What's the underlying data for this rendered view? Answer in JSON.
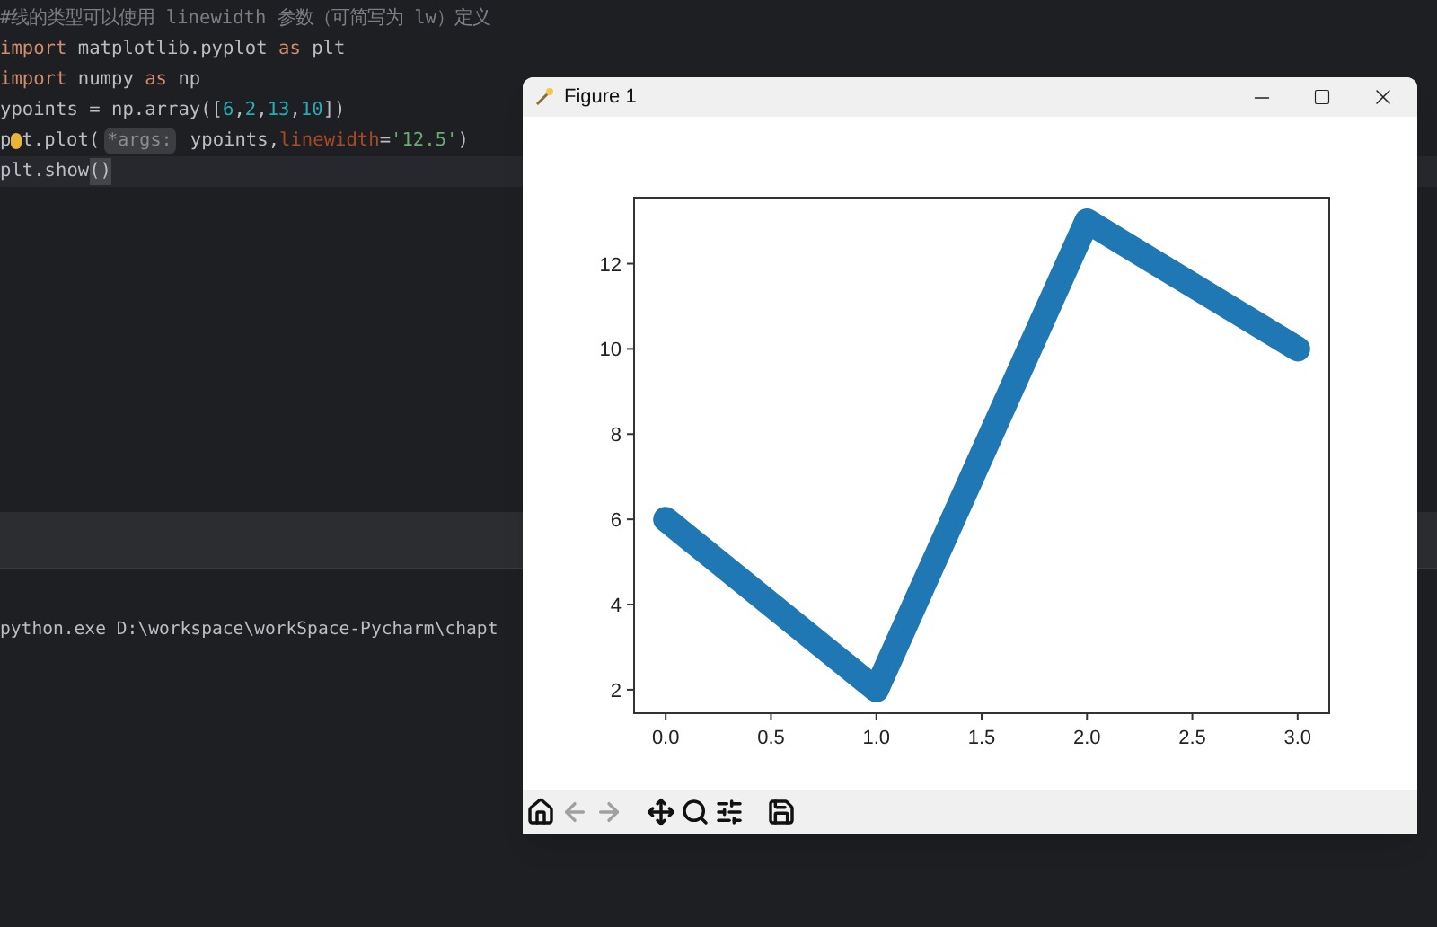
{
  "editor": {
    "lines": [
      {
        "current": false,
        "tokens": [
          {
            "kind": "comment",
            "text": "#线的类型可以使用 linewidth 参数（可简写为 lw）定义"
          }
        ]
      },
      {
        "current": false,
        "tokens": [
          {
            "kind": "keyword",
            "text": "import"
          },
          {
            "kind": "plain",
            "text": " matplotlib.pyplot "
          },
          {
            "kind": "keyword",
            "text": "as"
          },
          {
            "kind": "plain",
            "text": " plt"
          }
        ]
      },
      {
        "current": false,
        "tokens": [
          {
            "kind": "keyword",
            "text": "import"
          },
          {
            "kind": "plain",
            "text": " numpy "
          },
          {
            "kind": "keyword",
            "text": "as"
          },
          {
            "kind": "plain",
            "text": " np"
          }
        ]
      },
      {
        "current": false,
        "tokens": [
          {
            "kind": "plain",
            "text": "ypoints = np.array(["
          },
          {
            "kind": "numbers",
            "text": "6,2,13,10"
          },
          {
            "kind": "plain",
            "text": "])"
          }
        ]
      },
      {
        "current": false,
        "tokens": [
          {
            "kind": "plain",
            "text": "p"
          },
          {
            "kind": "bulb"
          },
          {
            "kind": "plain",
            "text": "t.plot("
          },
          {
            "kind": "hint",
            "text": "*args:"
          },
          {
            "kind": "plain",
            "text": " ypoints,"
          },
          {
            "kind": "param",
            "text": "linewidth"
          },
          {
            "kind": "plain",
            "text": "="
          },
          {
            "kind": "string",
            "text": "'12.5'"
          },
          {
            "kind": "plain",
            "text": ")"
          }
        ]
      },
      {
        "current": true,
        "tokens": [
          {
            "kind": "plain",
            "text": "plt.show"
          },
          {
            "kind": "bracket",
            "text": "()"
          }
        ]
      }
    ]
  },
  "terminal": {
    "line": "python.exe D:\\workspace\\workSpace-Pycharm\\chapt"
  },
  "figure": {
    "title": "Figure 1",
    "chart_data": {
      "type": "line",
      "x": [
        0,
        1,
        2,
        3
      ],
      "series": [
        {
          "color": "#1f77b4",
          "values": [
            6,
            2,
            13,
            10
          ]
        }
      ],
      "xlim": [
        -0.15,
        3.15
      ],
      "ylim": [
        1.45,
        13.55
      ],
      "xticks": [
        {
          "value": 0,
          "label": "0.0"
        },
        {
          "value": 0.5,
          "label": "0.5"
        },
        {
          "value": 1,
          "label": "1.0"
        },
        {
          "value": 1.5,
          "label": "1.5"
        },
        {
          "value": 2,
          "label": "2.0"
        },
        {
          "value": 2.5,
          "label": "2.5"
        },
        {
          "value": 3,
          "label": "3.0"
        }
      ],
      "yticks": [
        2,
        4,
        6,
        8,
        10,
        12
      ]
    },
    "toolbar": [
      {
        "kind": "home",
        "disabled": false
      },
      {
        "kind": "back",
        "disabled": true
      },
      {
        "kind": "forward",
        "disabled": true
      },
      {
        "kind": "pan",
        "disabled": false
      },
      {
        "kind": "zoom",
        "disabled": false
      },
      {
        "kind": "configure",
        "disabled": false
      },
      {
        "kind": "save",
        "disabled": false
      }
    ]
  }
}
